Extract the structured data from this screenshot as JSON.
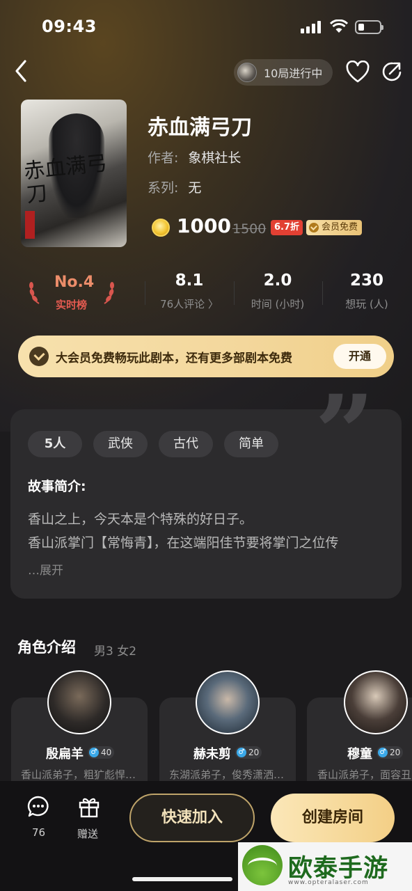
{
  "status_bar": {
    "time": "09:43"
  },
  "header": {
    "round_status": "10局进行中"
  },
  "script": {
    "title": "赤血满弓刀",
    "author_label": "作者:",
    "author": "象棋社长",
    "series_label": "系列:",
    "series": "无",
    "cover_text": "赤血满弓刀",
    "price": "1000",
    "original_price": "1500",
    "discount": "6.7折",
    "vip_free": "会员免费"
  },
  "stats": {
    "rank": "No.4",
    "rank_label": "实时榜",
    "rating": "8.1",
    "rating_label": "76人评论 〉",
    "time": "2.0",
    "time_label": "时间 (小时)",
    "want": "230",
    "want_label": "想玩 (人)"
  },
  "vip_banner": {
    "text": "大会员免费畅玩此剧本，还有更多部剧本免费",
    "button": "开通"
  },
  "story": {
    "tags": [
      "5人",
      "武侠",
      "古代",
      "简单"
    ],
    "heading": "故事简介:",
    "lines": [
      "香山之上，今天本是个特殊的好日子。",
      "香山派掌门【常悔青】，在这端阳佳节要将掌门之位传"
    ],
    "expand": "…展开"
  },
  "roles": {
    "heading": "角色介绍",
    "summary": "男3 女2",
    "items": [
      {
        "name": "殷扁羊",
        "age": "40",
        "desc": "香山派弟子，粗犷彪悍…"
      },
      {
        "name": "赫未剪",
        "age": "20",
        "desc": "东湖派弟子，俊秀潇洒…"
      },
      {
        "name": "穆童",
        "age": "20",
        "desc": "香山派弟子，面容丑"
      }
    ]
  },
  "bottom_bar": {
    "comments_count": "76",
    "gift_label": "赠送",
    "join_label": "快速加入",
    "create_label": "创建房间"
  },
  "watermark": {
    "text": "欧泰手游网",
    "url": "www.opteralaser.com"
  }
}
